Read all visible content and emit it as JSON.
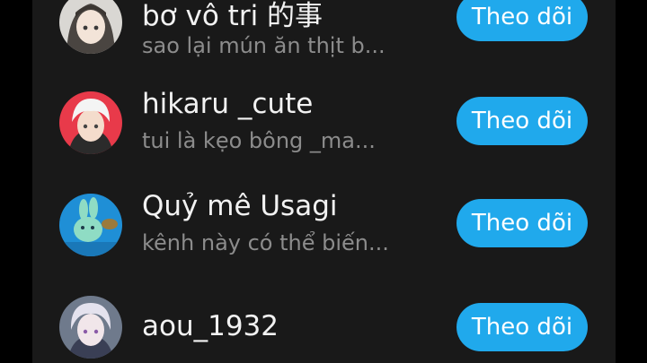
{
  "follow_label": "Theo dõi",
  "users": [
    {
      "name": "bơ vô tri 的事",
      "subtitle": "sao lại mún ăn thịt b...",
      "avatar_icon": "anime-girl-avatar-icon"
    },
    {
      "name": "hikaru _cute",
      "subtitle": "tui là kẹo bông _ma...",
      "avatar_icon": "white-hair-boy-avatar-icon"
    },
    {
      "name": "Quỷ mê Usagi",
      "subtitle": "kênh này có thể biến...",
      "avatar_icon": "usagi-rabbit-avatar-icon"
    },
    {
      "name": "aou_1932",
      "subtitle": "",
      "avatar_icon": "silver-hair-avatar-icon"
    }
  ],
  "colors": {
    "background": "#191919",
    "button": "#20a9ec",
    "name_text": "#f2f2f2",
    "subtitle_text": "#8c8c8c"
  }
}
